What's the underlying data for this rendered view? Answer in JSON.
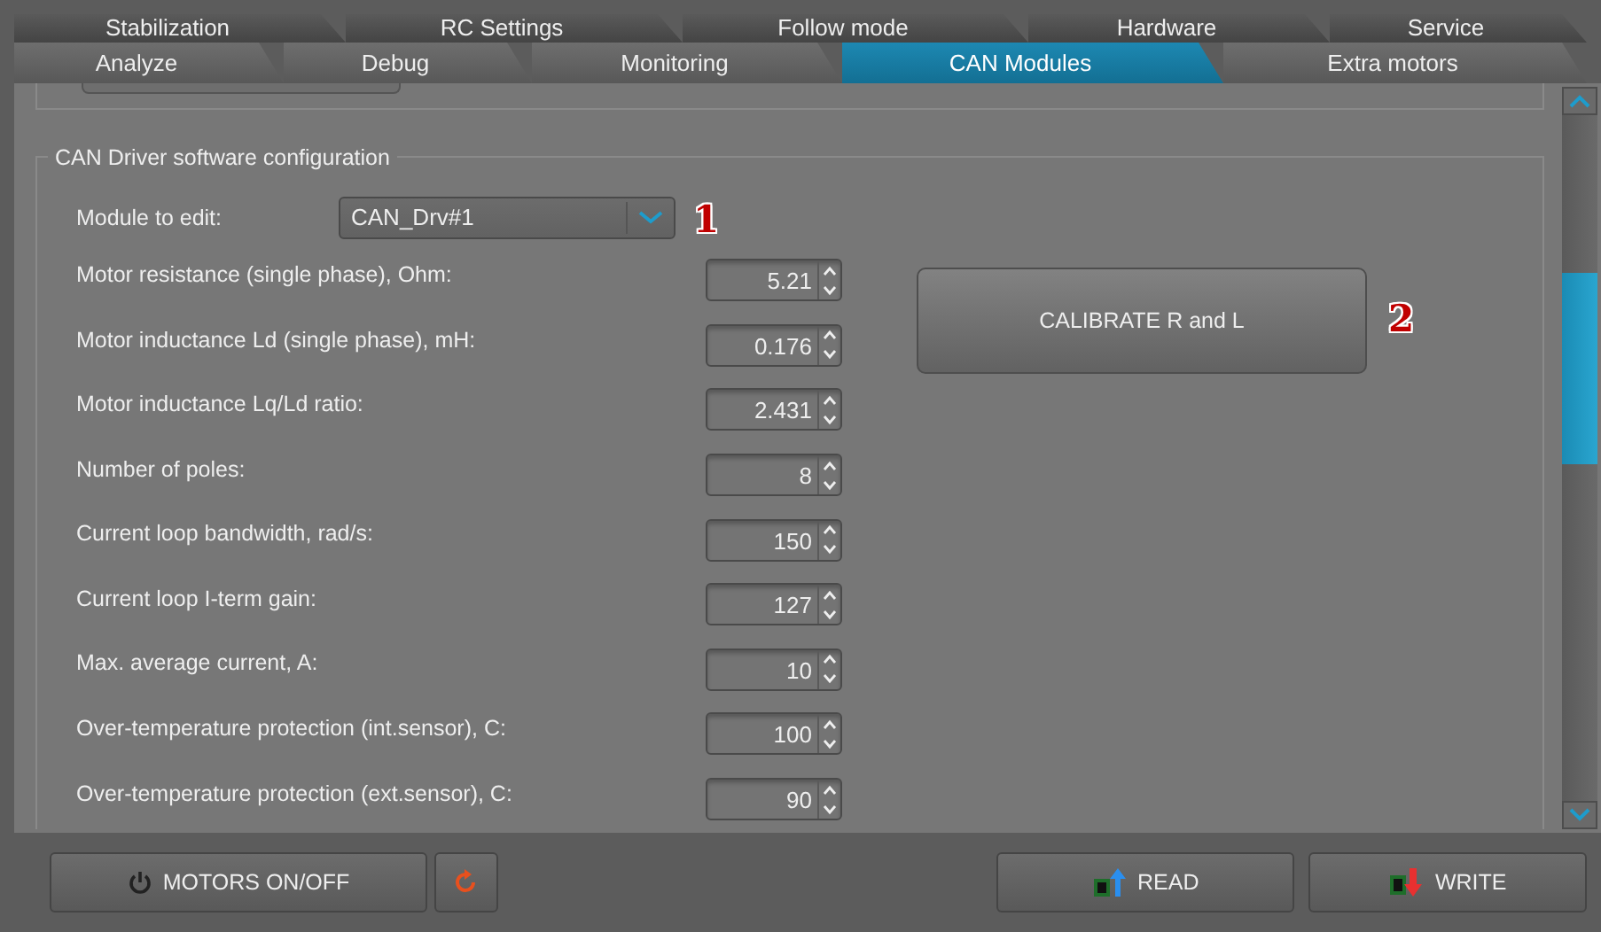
{
  "tabs_row_1": [
    {
      "label": "Stabilization",
      "selected": false
    },
    {
      "label": "RC Settings",
      "selected": false
    },
    {
      "label": "Follow mode",
      "selected": false
    },
    {
      "label": "Hardware",
      "selected": false
    },
    {
      "label": "Service",
      "selected": false
    }
  ],
  "tabs_row_2": [
    {
      "label": "Analyze",
      "selected": false
    },
    {
      "label": "Debug",
      "selected": false
    },
    {
      "label": "Monitoring",
      "selected": false
    },
    {
      "label": "CAN Modules",
      "selected": true
    },
    {
      "label": "Extra motors",
      "selected": false
    }
  ],
  "group": {
    "title": "CAN Driver software configuration",
    "module_select": {
      "label": "Module to edit:",
      "value": "CAN_Drv#1",
      "annotation": "1"
    },
    "parameters": [
      {
        "label": "Motor resistance (single phase), Ohm:",
        "value": "5.21"
      },
      {
        "label": "Motor inductance Ld (single phase), mH:",
        "value": "0.176"
      },
      {
        "label": "Motor inductance Lq/Ld ratio:",
        "value": "2.431"
      },
      {
        "label": "Number of poles:",
        "value": "8"
      },
      {
        "label": "Current loop bandwidth, rad/s:",
        "value": "150"
      },
      {
        "label": "Current loop I-term gain:",
        "value": "127"
      },
      {
        "label": "Max. average current, A:",
        "value": "10"
      },
      {
        "label": "Over-temperature protection (int.sensor), C:",
        "value": "100"
      },
      {
        "label": "Over-temperature protection (ext.sensor), C:",
        "value": "90"
      }
    ],
    "calibrate_button": {
      "label": "CALIBRATE R and L",
      "annotation": "2"
    }
  },
  "bottom_buttons": [
    {
      "kind": "power",
      "label": "MOTORS ON/OFF"
    },
    {
      "kind": "refresh"
    },
    {
      "kind": "read",
      "label": "READ"
    },
    {
      "kind": "write",
      "label": "WRITE"
    }
  ]
}
